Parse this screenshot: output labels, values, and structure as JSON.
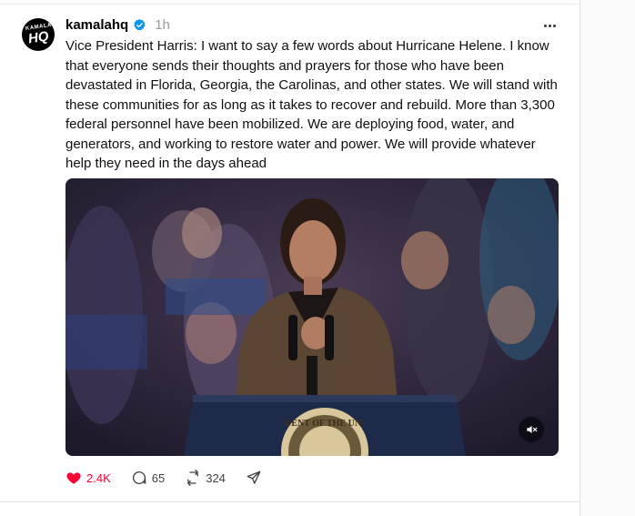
{
  "post": {
    "username": "kamalahq",
    "timestamp": "1h",
    "avatar_text_top": "KAMALA",
    "avatar_text_main": "HQ",
    "text": "Vice President Harris: I want to say a few words about Hurricane Helene. I know that everyone sends their thoughts and prayers for those who have been devastated in Florida, Georgia, the Carolinas, and other states. We will stand with these communities for as long as it takes to recover and rebuild. More than 3,300 federal personnel have been mobilized. We are deploying food, water, and generators, and working to restore water and power. We will provide whatever help they need in the days ahead",
    "media": {
      "seal_text": "DENT OF THE UNI"
    }
  },
  "actions": {
    "likes": "2.4K",
    "replies": "65",
    "reposts": "324"
  },
  "colors": {
    "like": "#ff0034",
    "verified": "#0095f6",
    "muted_text": "#999999"
  },
  "icons": [
    "verified-badge-icon",
    "more-options-icon",
    "mute-icon",
    "heart-icon",
    "comment-icon",
    "repost-icon",
    "share-icon"
  ]
}
